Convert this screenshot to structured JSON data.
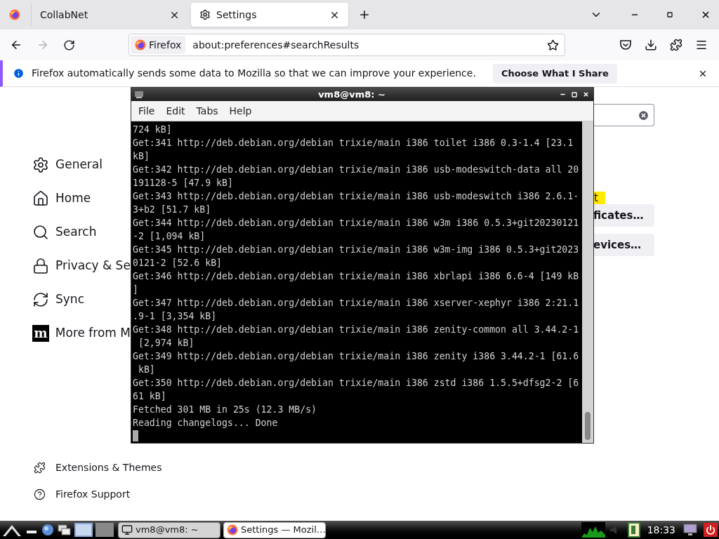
{
  "browser": {
    "tabs": [
      {
        "title": "CollabNet",
        "selected": false
      },
      {
        "title": "Settings",
        "selected": true
      }
    ],
    "address": {
      "identity": "Firefox",
      "url": "about:preferences#searchResults"
    },
    "notification": {
      "text": "Firefox automatically sends some data to Mozilla so that we can improve your experience.",
      "button": "Choose What I Share"
    }
  },
  "settings": {
    "nav": [
      {
        "label": "General",
        "kind": "general"
      },
      {
        "label": "Home",
        "kind": "home"
      },
      {
        "label": "Search",
        "kind": "search"
      },
      {
        "label": "Privacy & Se",
        "kind": "privacy"
      },
      {
        "label": "Sync",
        "kind": "sync"
      },
      {
        "label": "More from M",
        "kind": "more",
        "logo_text": "m"
      }
    ],
    "footer_links": [
      {
        "label": "Extensions & Themes",
        "kind": "addons"
      },
      {
        "label": "Firefox Support",
        "kind": "support"
      }
    ],
    "highlight": "t",
    "buttons": [
      "ficates…",
      "evices…"
    ]
  },
  "terminal": {
    "title": "vm8@vm8: ~",
    "menu": [
      "File",
      "Edit",
      "Tabs",
      "Help"
    ],
    "lines": [
      "724 kB]",
      "Get:341 http://deb.debian.org/debian trixie/main i386 toilet i386 0.3-1.4 [23.1",
      "kB]",
      "Get:342 http://deb.debian.org/debian trixie/main i386 usb-modeswitch-data all 20",
      "191128-5 [47.9 kB]",
      "Get:343 http://deb.debian.org/debian trixie/main i386 usb-modeswitch i386 2.6.1-",
      "3+b2 [51.7 kB]",
      "Get:344 http://deb.debian.org/debian trixie/main i386 w3m i386 0.5.3+git20230121",
      "-2 [1,094 kB]",
      "Get:345 http://deb.debian.org/debian trixie/main i386 w3m-img i386 0.5.3+git2023",
      "0121-2 [52.6 kB]",
      "Get:346 http://deb.debian.org/debian trixie/main i386 xbrlapi i386 6.6-4 [149 kB",
      "]",
      "Get:347 http://deb.debian.org/debian trixie/main i386 xserver-xephyr i386 2:21.1",
      ".9-1 [3,354 kB]",
      "Get:348 http://deb.debian.org/debian trixie/main i386 zenity-common all 3.44.2-1",
      " [2,974 kB]",
      "Get:349 http://deb.debian.org/debian trixie/main i386 zenity i386 3.44.2-1 [61.6",
      " kB]",
      "Get:350 http://deb.debian.org/debian trixie/main i386 zstd i386 1.5.5+dfsg2-2 [6",
      "61 kB]",
      "Fetched 301 MB in 25s (12.3 MB/s)",
      "Reading changelogs... Done"
    ]
  },
  "taskbar": {
    "windows": [
      {
        "label": "vm8@vm8: ~",
        "kind": "terminal",
        "selected": false
      },
      {
        "label": "Settings — Mozil…",
        "kind": "browser",
        "selected": true
      }
    ],
    "clock": "18:33"
  }
}
